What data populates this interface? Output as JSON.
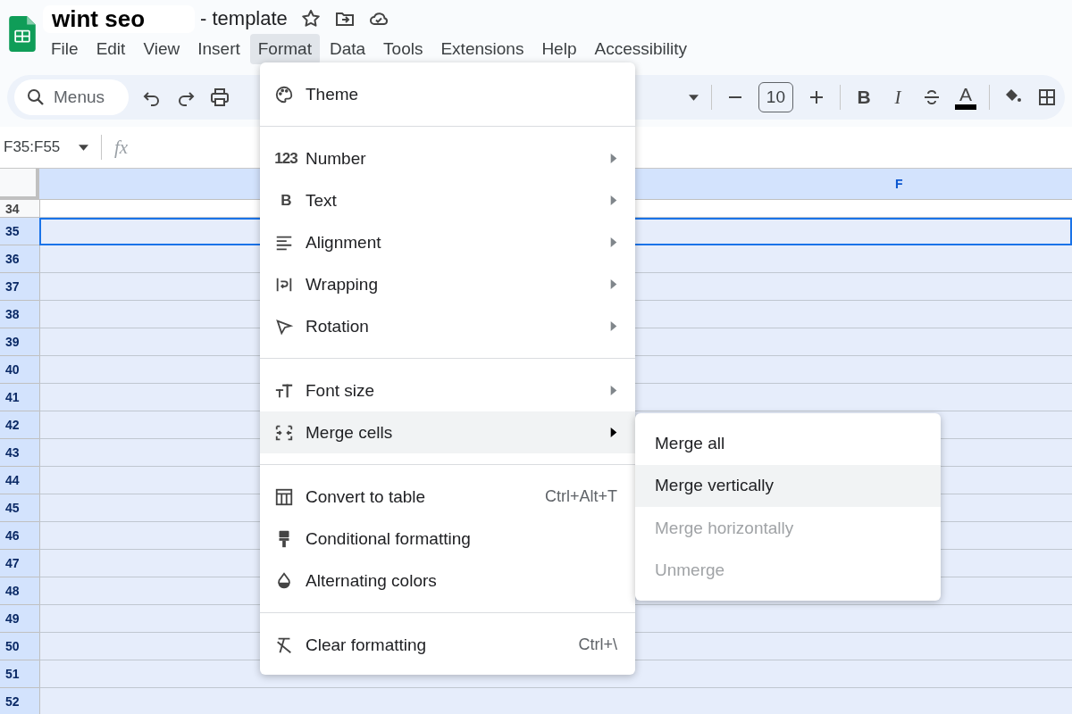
{
  "document": {
    "title": "wint seo",
    "suffix": "- template"
  },
  "menubar": [
    {
      "label": "File",
      "selected": false
    },
    {
      "label": "Edit",
      "selected": false
    },
    {
      "label": "View",
      "selected": false
    },
    {
      "label": "Insert",
      "selected": false
    },
    {
      "label": "Format",
      "selected": true
    },
    {
      "label": "Data",
      "selected": false
    },
    {
      "label": "Tools",
      "selected": false
    },
    {
      "label": "Extensions",
      "selected": false
    },
    {
      "label": "Help",
      "selected": false
    },
    {
      "label": "Accessibility",
      "selected": false
    }
  ],
  "toolbar": {
    "search_placeholder": "Menus",
    "font_size": "10",
    "bold": "B",
    "italic": "I",
    "text_color": "A"
  },
  "formula_bar": {
    "name_box": "F35:F55",
    "fx": "fx"
  },
  "grid": {
    "column": {
      "label": "F",
      "selected": true
    },
    "rows": [
      {
        "label": "34",
        "selected": false,
        "active": false
      },
      {
        "label": "35",
        "selected": true,
        "active": true
      },
      {
        "label": "36",
        "selected": true,
        "active": false
      },
      {
        "label": "37",
        "selected": true,
        "active": false
      },
      {
        "label": "38",
        "selected": true,
        "active": false
      },
      {
        "label": "39",
        "selected": true,
        "active": false
      },
      {
        "label": "40",
        "selected": true,
        "active": false
      },
      {
        "label": "41",
        "selected": true,
        "active": false
      },
      {
        "label": "42",
        "selected": true,
        "active": false
      },
      {
        "label": "43",
        "selected": true,
        "active": false
      },
      {
        "label": "44",
        "selected": true,
        "active": false
      },
      {
        "label": "45",
        "selected": true,
        "active": false
      },
      {
        "label": "46",
        "selected": true,
        "active": false
      },
      {
        "label": "47",
        "selected": true,
        "active": false
      },
      {
        "label": "48",
        "selected": true,
        "active": false
      },
      {
        "label": "49",
        "selected": true,
        "active": false
      },
      {
        "label": "50",
        "selected": true,
        "active": false
      },
      {
        "label": "51",
        "selected": true,
        "active": false
      },
      {
        "label": "52",
        "selected": true,
        "active": false
      }
    ]
  },
  "format_menu": [
    [
      {
        "label": "Theme",
        "submenu": false,
        "selected": false
      }
    ],
    [
      {
        "label": "Number",
        "icon_text": "123",
        "submenu": true,
        "selected": false
      },
      {
        "label": "Text",
        "icon_text": "B",
        "submenu": true,
        "selected": false
      },
      {
        "label": "Alignment",
        "submenu": true,
        "selected": false
      },
      {
        "label": "Wrapping",
        "submenu": true,
        "selected": false
      },
      {
        "label": "Rotation",
        "submenu": true,
        "selected": false
      }
    ],
    [
      {
        "label": "Font size",
        "submenu": true,
        "selected": false
      },
      {
        "label": "Merge cells",
        "submenu": true,
        "selected": true
      }
    ],
    [
      {
        "label": "Convert to table",
        "submenu": false,
        "shortcut": "Ctrl+Alt+T",
        "selected": false
      },
      {
        "label": "Conditional formatting",
        "submenu": false,
        "selected": false
      },
      {
        "label": "Alternating colors",
        "submenu": false,
        "selected": false
      }
    ],
    [
      {
        "label": "Clear formatting",
        "submenu": false,
        "shortcut": "Ctrl+\\",
        "selected": false
      }
    ]
  ],
  "merge_submenu": [
    {
      "label": "Merge all",
      "selected": false,
      "disabled": false
    },
    {
      "label": "Merge vertically",
      "selected": true,
      "disabled": false
    },
    {
      "label": "Merge horizontally",
      "selected": false,
      "disabled": true
    },
    {
      "label": "Unmerge",
      "selected": false,
      "disabled": true
    }
  ]
}
